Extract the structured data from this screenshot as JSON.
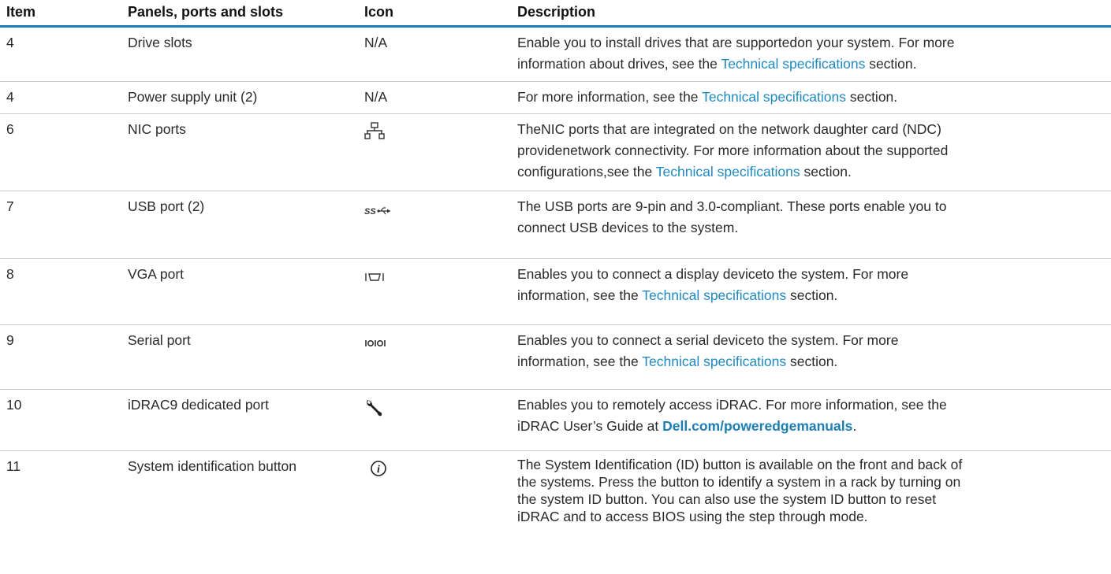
{
  "table": {
    "headers": {
      "item": "Item",
      "panel": "Panels, ports and slots",
      "icon": "Icon",
      "description": "Description"
    },
    "rows": [
      {
        "item": "4",
        "name": "Drive slots",
        "icon_text": "N/A",
        "desc": {
          "line1": "Enable you to install drives that are supportedon your system. For more",
          "line2_pre": "information about drives, see the ",
          "link": "Technical specifications",
          "line2_post": " section."
        }
      },
      {
        "item": "4",
        "name": "Power supply unit (2)",
        "icon_text": "N/A",
        "desc": {
          "pre": "For more information, see the ",
          "link": "Technical specifications",
          "post": " section."
        }
      },
      {
        "item": "6",
        "name": "NIC ports",
        "icon": "network-icon",
        "desc": {
          "line1": "TheNIC ports that are integrated on the network daughter card (NDC)",
          "line2": "providenetwork connectivity. For more information about the supported",
          "line3_pre": "configurations,see the ",
          "link": "Technical specifications",
          "line3_post": " section."
        }
      },
      {
        "item": "7",
        "name": "USB port (2)",
        "icon": "usb-superspeed-icon",
        "icon_label": "SS",
        "desc": {
          "line1": "The USB ports are 9-pin and 3.0-compliant. These ports enable you to",
          "line2": "connect USB devices to the system."
        }
      },
      {
        "item": "8",
        "name": "VGA port",
        "icon": "vga-icon",
        "icon_label": "I◯I",
        "desc": {
          "line1": "Enables you to connect a display deviceto the system. For more",
          "line2_pre": "information, see the ",
          "link": "Technical specifications",
          "line2_post": " section."
        }
      },
      {
        "item": "9",
        "name": "Serial port",
        "icon": "serial-icon",
        "icon_label": "IOIOI",
        "desc": {
          "line1": "Enables you to connect a serial deviceto the system. For more",
          "line2_pre": "information, see the ",
          "link": "Technical specifications",
          "line2_post": " section."
        }
      },
      {
        "item": "10",
        "name": "iDRAC9 dedicated port",
        "icon": "wrench-icon",
        "desc": {
          "line1": "Enables you to remotely access iDRAC. For more information, see the",
          "line2_pre": "iDRAC User’s Guide at ",
          "link": "Dell.com/poweredgemanuals",
          "line2_post": "."
        }
      },
      {
        "item": "11",
        "name": "System identification button",
        "icon": "info-icon",
        "icon_label": "i",
        "desc": {
          "line1": "The System Identification (ID) button is available on the front and back of",
          "line2": "the systems. Press the button to identify a system in a rack by turning on",
          "line3": "the system ID button. You can also use the system ID button to reset",
          "line4": "iDRAC and to access BIOS using the step through mode."
        }
      }
    ]
  },
  "colors": {
    "header_rule": "#1a7fb8",
    "link": "#1a8ac8",
    "row_separator": "#c9c9c9"
  }
}
